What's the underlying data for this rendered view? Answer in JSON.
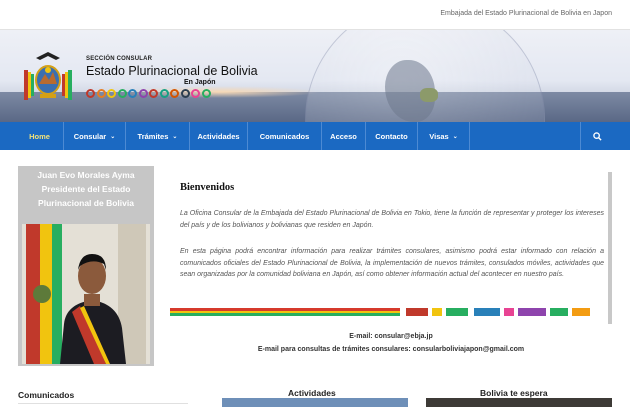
{
  "topbar": {
    "text": "Embajada del Estado Plurinacional de Bolivia en Japon"
  },
  "banner": {
    "small_title": "SECCIÓN CONSULAR",
    "big_title": "Estado Plurinacional de Bolivia",
    "country": "En Japón",
    "dot_colors": [
      "#c0392b",
      "#e67e22",
      "#f1c40f",
      "#27ae60",
      "#2980b9",
      "#8e44ad",
      "#c0392b",
      "#16a085",
      "#d35400",
      "#2c3e50",
      "#e84393",
      "#27ae60"
    ]
  },
  "nav": {
    "items": [
      {
        "label": "Home",
        "caret": ""
      },
      {
        "label": "Consular",
        "caret": "⌄"
      },
      {
        "label": "Trámites",
        "caret": "⌄"
      },
      {
        "label": "Actividades",
        "caret": ""
      },
      {
        "label": "Comunicados",
        "caret": ""
      },
      {
        "label": "Acceso",
        "caret": ""
      },
      {
        "label": "Contacto",
        "caret": ""
      },
      {
        "label": "Visas",
        "caret": "⌄"
      }
    ]
  },
  "president": {
    "name": "Juan Evo Morales Ayma",
    "role_line1": "Presidente del Estado",
    "role_line2": "Plurinacional de Bolivia"
  },
  "welcome": {
    "title": "Bienvenidos",
    "p1": "La Oficina Consular de la Embajada del Estado Plurinacional de Bolivia en Tokio, tiene la función de representar y proteger los intereses del país y de los bolivianos y bolivianas que residen en Japón.",
    "p2": "En esta página podrá encontrar información para realizar trámites consulares, asimismo podrá estar informado con relación a comunicados oficiales del Estado Plurinacional de Bolivia, la implementación de nuevos trámites, consulados móviles, actividades que sean organizadas por la comunidad boliviana en Japón, así como obtener información actual del acontecer en nuestro país.",
    "email": "E-mail: consular@ebja.jp",
    "email2": "E-mail para consultas de trámites consulares: consularboliviajapon@gmail.com"
  },
  "sections": {
    "comunicados": "Comunicados",
    "actividades": "Actividades",
    "bolivia": "Bolivia te espera"
  },
  "colors": {
    "nav_blue": "#1b69c2",
    "active_text": "#f1e27a"
  }
}
